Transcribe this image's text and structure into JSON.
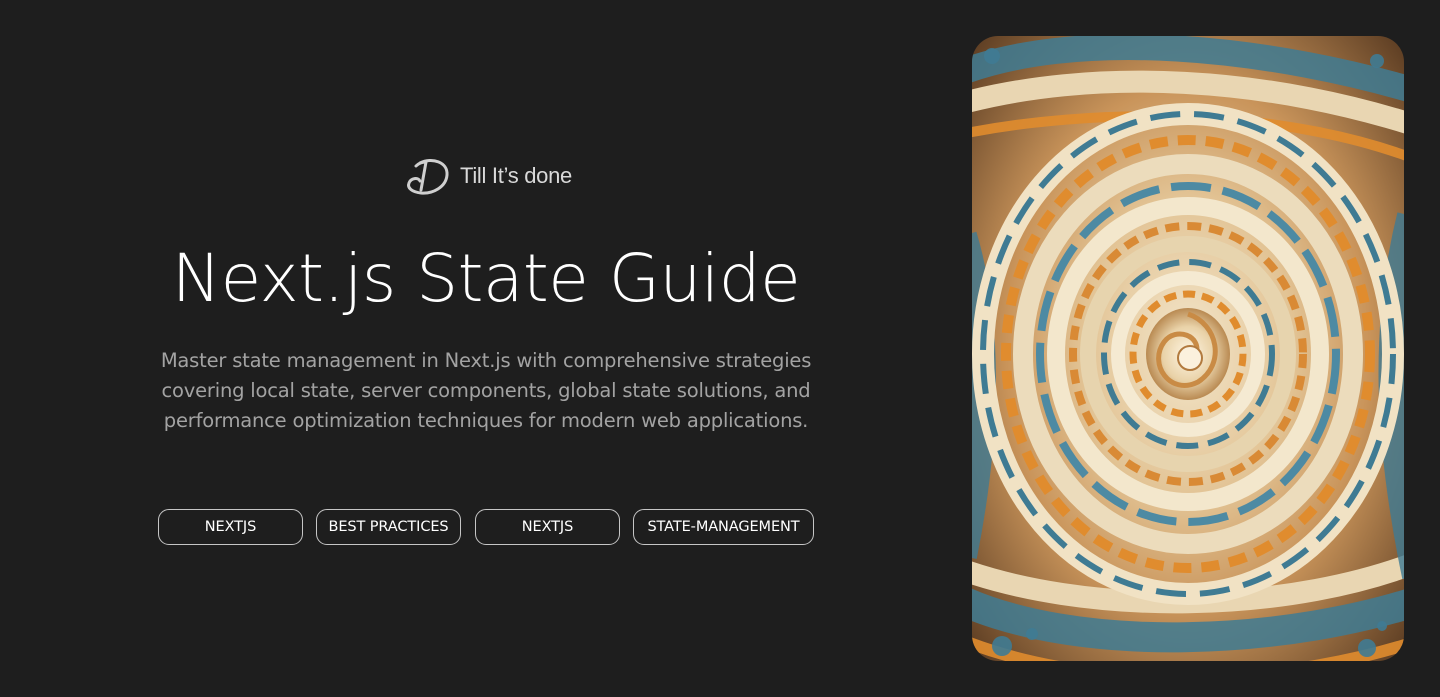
{
  "brand": {
    "name": "Till It’s done",
    "logo_icon": "d-monogram-logo-icon"
  },
  "hero": {
    "title": "Next.js State Guide",
    "description": "Master state management in Next.js with comprehensive strategies covering local state, server components, global state solutions, and performance optimization techniques for modern web applications."
  },
  "tags": [
    {
      "label": "NEXTJS"
    },
    {
      "label": "BEST PRACTICES"
    },
    {
      "label": "NEXTJS"
    },
    {
      "label": "STATE-MANAGEMENT"
    }
  ],
  "cover_image": {
    "icon": "abstract-swirl-artwork",
    "colors": [
      "#e8d3ae",
      "#e08c2e",
      "#3f7b93",
      "#6b4a2a"
    ]
  },
  "colors": {
    "background": "#1e1e1e",
    "title": "#ffffff",
    "description": "#a3a3a3",
    "tag_border": "#c6c6c6"
  }
}
